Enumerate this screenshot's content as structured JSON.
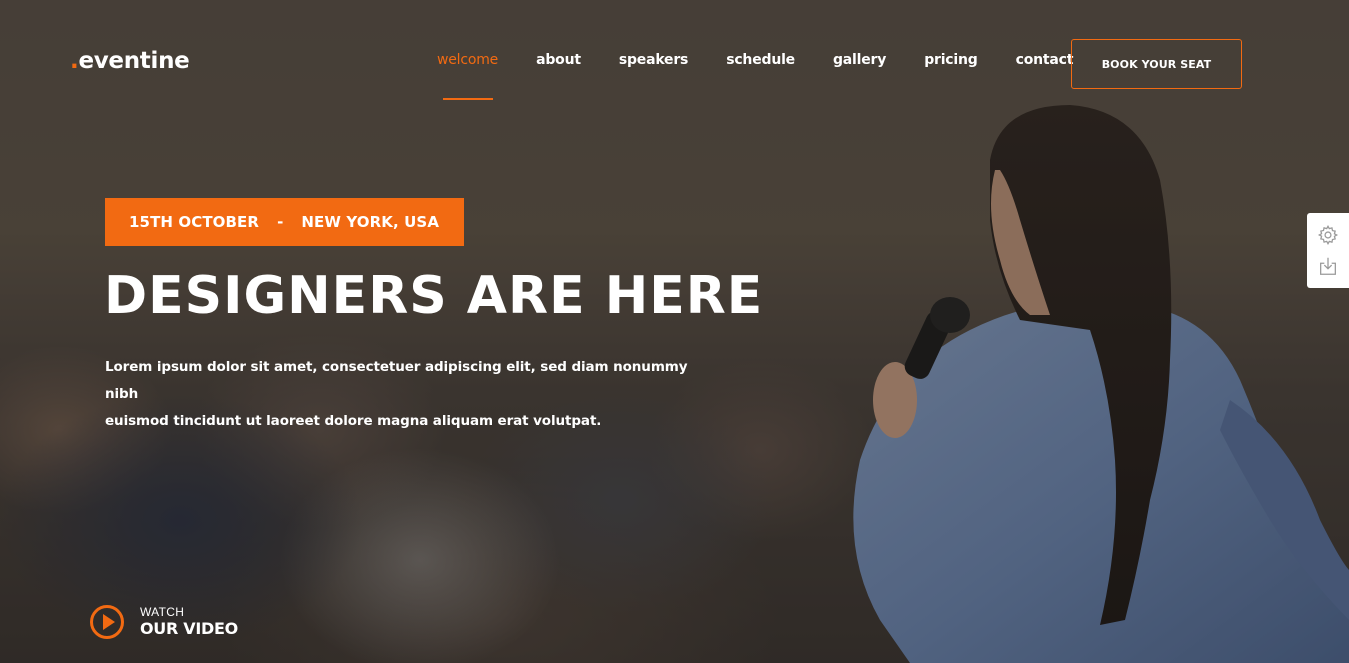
{
  "header": {
    "logo_dot": ".",
    "logo_text": "eventine",
    "nav": [
      {
        "label": "welcome",
        "active": true
      },
      {
        "label": "about",
        "active": false
      },
      {
        "label": "speakers",
        "active": false
      },
      {
        "label": "schedule",
        "active": false
      },
      {
        "label": "gallery",
        "active": false
      },
      {
        "label": "pricing",
        "active": false
      },
      {
        "label": "contact",
        "active": false
      }
    ],
    "cta_label": "BOOK YOUR SEAT"
  },
  "hero": {
    "date": "15TH OCTOBER",
    "separator": "-",
    "location": "NEW YORK, USA",
    "title": "DESIGNERS ARE HERE",
    "description_line1": "Lorem ipsum dolor sit amet, consectetuer adipiscing elit, sed diam nonummy nibh",
    "description_line2": "euismod tincidunt ut laoreet dolore magna aliquam erat volutpat.",
    "watch_small": "WATCH",
    "watch_big": "OUR VIDEO"
  },
  "side_tools": [
    {
      "icon": "gear-icon"
    },
    {
      "icon": "download-icon"
    }
  ],
  "colors": {
    "accent": "#f26a12",
    "text": "#ffffff"
  }
}
